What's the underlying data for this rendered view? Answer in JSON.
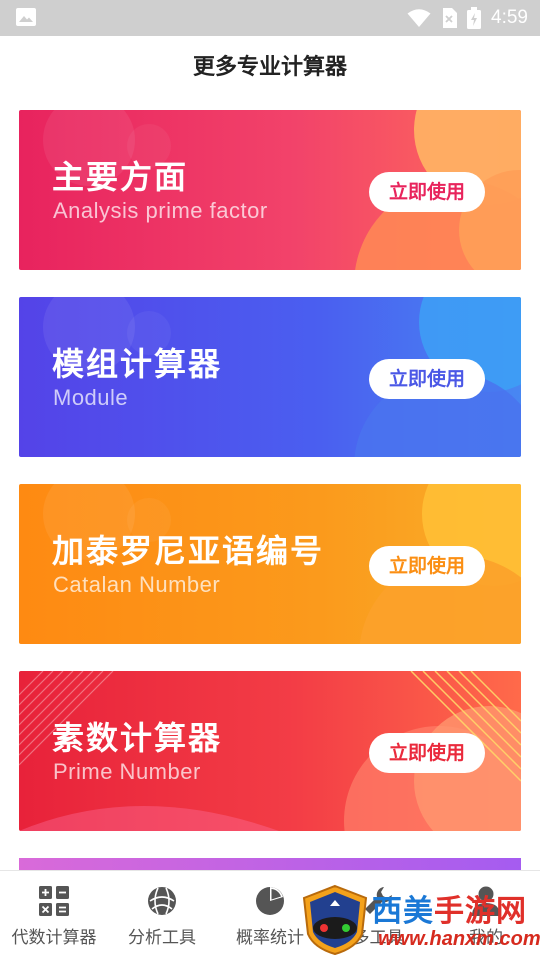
{
  "status_bar": {
    "time": "4:59"
  },
  "page": {
    "title": "更多专业计算器"
  },
  "cards": [
    {
      "title": "主要方面",
      "subtitle": "Analysis prime factor",
      "button": "立即使用",
      "accent": "#e8245c"
    },
    {
      "title": "模组计算器",
      "subtitle": "Module",
      "button": "立即使用",
      "accent": "#4b58e6"
    },
    {
      "title": "加泰罗尼亚语编号",
      "subtitle": "Catalan  Number",
      "button": "立即使用",
      "accent": "#fb8f14"
    },
    {
      "title": "素数计算器",
      "subtitle": "Prime Number",
      "button": "立即使用",
      "accent": "#ea2a3c"
    }
  ],
  "tabs": [
    {
      "label": "代数计算器",
      "icon": "calculator-grid-icon"
    },
    {
      "label": "分析工具",
      "icon": "globe-icon"
    },
    {
      "label": "概率统计",
      "icon": "pie-chart-icon"
    },
    {
      "label": "多工具",
      "icon": "wrench-icon"
    },
    {
      "label": "我的",
      "icon": "person-icon"
    }
  ],
  "watermark": {
    "text_a": "西美",
    "text_b": "手游网",
    "url": "www.hanxm.com"
  }
}
